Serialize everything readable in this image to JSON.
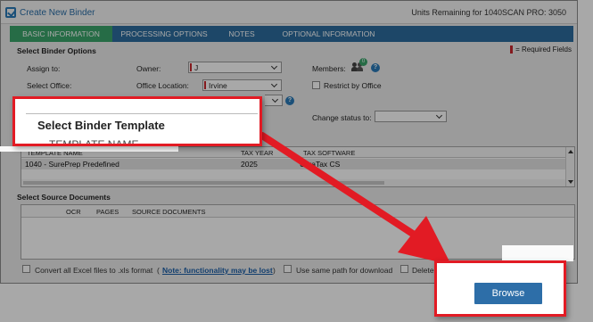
{
  "window": {
    "title": "Create New Binder",
    "units_label": "Units Remaining for 1040SCAN PRO: 3050"
  },
  "tabs": [
    {
      "label": "BASIC INFORMATION",
      "active": true
    },
    {
      "label": "PROCESSING OPTIONS",
      "active": false
    },
    {
      "label": "NOTES",
      "active": false
    },
    {
      "label": "OPTIONAL INFORMATION",
      "active": false
    }
  ],
  "binder_options": {
    "section_title": "Select Binder Options",
    "required_note": "= Required Fields",
    "assign_to_label": "Assign to:",
    "owner_label": "Owner:",
    "owner_value": "J",
    "members_label": "Members:",
    "members_count": "0",
    "select_office_label": "Select Office:",
    "office_location_label": "Office Location:",
    "office_location_value": "Irvine",
    "restrict_by_office_label": "Restrict by Office",
    "change_status_label": "Change status to:",
    "change_status_value": ""
  },
  "template_grid": {
    "columns": [
      "TEMPLATE NAME",
      "TAX YEAR",
      "TAX SOFTWARE"
    ],
    "rows": [
      {
        "name": "1040 - SurePrep Predefined",
        "year": "2025",
        "software": "UltraTax CS"
      }
    ]
  },
  "source_documents": {
    "section_title": "Select Source Documents",
    "columns": [
      "OCR",
      "PAGES",
      "SOURCE DOCUMENTS"
    ]
  },
  "footer": {
    "convert_label": "Convert all Excel files to .xls format",
    "note_link": "Note: functionality may be lost",
    "same_path_label": "Use same path for download",
    "delete_label": "Delete"
  },
  "zoom_template": {
    "heading": "Select Binder Template",
    "subheading": "TEMPLATE NAME"
  },
  "zoom_browse": {
    "button_label": "Browse"
  },
  "colors": {
    "tab_bar": "#2d6d9e",
    "tab_active": "#3aa56b",
    "callout_red": "#e21b24",
    "browse_button": "#2d6ea8",
    "required_marker": "#c8262c"
  }
}
